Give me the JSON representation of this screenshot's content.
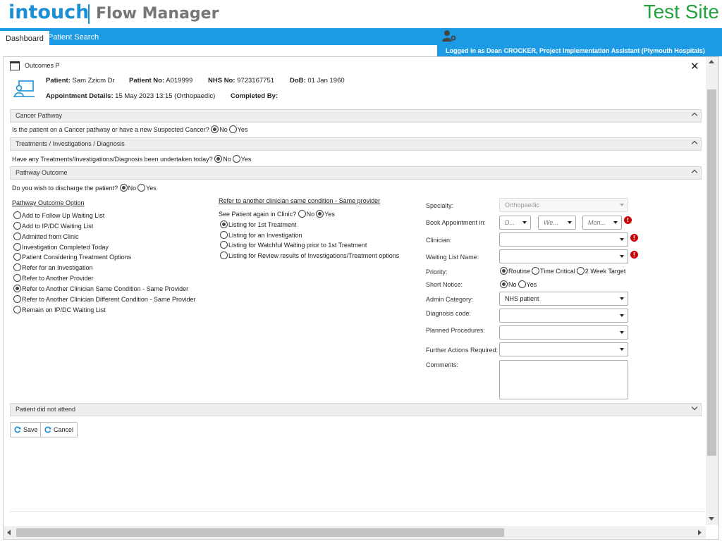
{
  "brand": {
    "name": "intouch",
    "product": "Flow Manager",
    "site_label": "Test Site"
  },
  "nav": {
    "tabs": [
      "Dashboard",
      "Patient Search"
    ],
    "logged_in": "Logged in as Dean CROCKER, Project Implementation Assistant (Plymouth Hospitals)"
  },
  "window": {
    "title": "Outcomes P"
  },
  "patient": {
    "name_label": "Patient:",
    "name": "Sam Zzicm Dr",
    "no_label": "Patient No:",
    "no": "A019999",
    "nhs_label": "NHS No:",
    "nhs": "9723167751",
    "dob_label": "DoB:",
    "dob": "01 Jan 1960",
    "appt_label": "Appointment Details:",
    "appt": "15 May 2023 13:15 (Orthopaedic)",
    "completed_label": "Completed By:"
  },
  "sections": {
    "cancer": {
      "title": "Cancer Pathway",
      "question": "Is the patient on a Cancer pathway or have a new Suspected Cancer?",
      "options": [
        "No",
        "Yes"
      ]
    },
    "treatments": {
      "title": "Treatments / Investigations / Diagnosis",
      "question": "Have any Treatments/Investigations/Diagnosis been undertaken today?",
      "options": [
        "No",
        "Yes"
      ]
    },
    "pathway": {
      "title": "Pathway Outcome",
      "discharge_question": "Do you wish to discharge the patient?",
      "discharge_options": [
        "No",
        "Yes"
      ],
      "option_heading": "Pathway Outcome Option",
      "options": [
        "Add to Follow Up Waiting List",
        "Add to IP/DC Waiting List",
        "Admitted from Clinic",
        "Investigation Completed Today",
        "Patient Considering Treatment Options",
        "Refer for an Investigation",
        "Refer to Another Provider",
        "Refer to Another Clinician Same Condition - Same Provider",
        "Refer to Another Clinician Different Condition - Same Provider",
        "Remain on IP/DC Waiting List"
      ],
      "refer_heading": "Refer to another clinician same condition - Same provider",
      "see_again_question": "See Patient again in Clinic?",
      "see_again_options": [
        "No",
        "Yes"
      ],
      "listing_options": [
        "Listing for 1st Treatment",
        "Listing for an Investigation",
        "Listing for Watchful Waiting prior to 1st Treatment",
        "Listing for Review results of Investigations/Treatment options"
      ],
      "form": {
        "specialty_label": "Specialty:",
        "specialty_value": "Orthopaedic",
        "book_label": "Book Appointment in:",
        "book_day": "D...",
        "book_week": "We...",
        "book_month": "Mon...",
        "clinician_label": "Clinician:",
        "waiting_list_label": "Waiting List Name:",
        "priority_label": "Priority:",
        "priority_options": [
          "Routine",
          "Time Critical",
          "2 Week Target"
        ],
        "short_notice_label": "Short Notice:",
        "short_notice_options": [
          "No",
          "Yes"
        ],
        "admin_label": "Admin Category:",
        "admin_value": "NHS patient",
        "diagnosis_label": "Diagnosis code:",
        "planned_label": "Planned Procedures:",
        "further_label": "Further Actions Required:",
        "comments_label": "Comments:"
      }
    },
    "dna": {
      "title": "Patient did not attend"
    }
  },
  "buttons": {
    "save": "Save",
    "cancel": "Cancel"
  },
  "colors": {
    "brand_blue": "#1b8fd6",
    "nav_blue": "#1d9ae4",
    "test_site_green": "#22a23e",
    "warning_red": "#cc0000"
  }
}
